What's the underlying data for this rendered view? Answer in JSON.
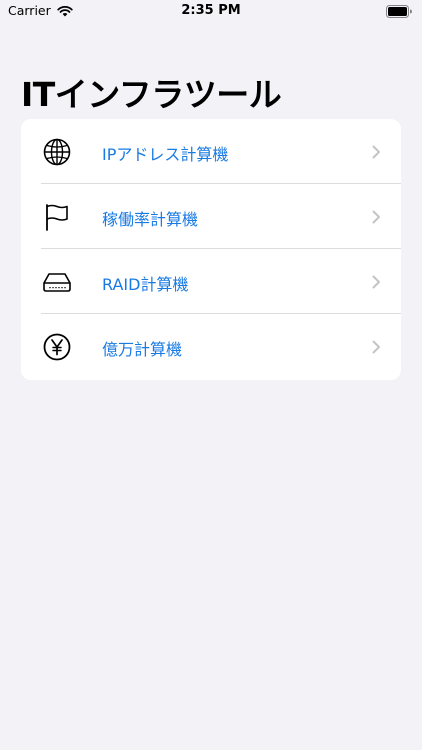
{
  "status_bar": {
    "carrier": "Carrier",
    "time": "2:35 PM"
  },
  "title": "ITインフラツール",
  "menu": {
    "items": [
      {
        "label": "IPアドレス計算機",
        "icon": "globe-icon"
      },
      {
        "label": "稼働率計算機",
        "icon": "flag-icon"
      },
      {
        "label": "RAID計算機",
        "icon": "hard-drive-icon"
      },
      {
        "label": "億万計算機",
        "icon": "yen-circle-icon"
      }
    ]
  },
  "colors": {
    "background": "#f2f2f7",
    "card": "#ffffff",
    "accent": "#1a7ae3",
    "chevron": "#c4c4c7",
    "separator": "#dcdce0"
  }
}
